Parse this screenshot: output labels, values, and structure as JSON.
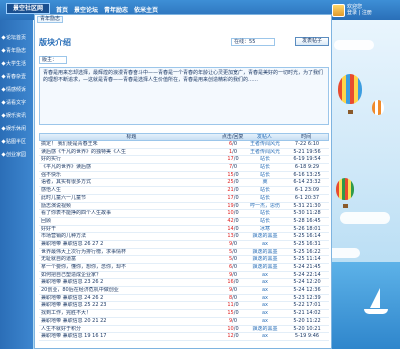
{
  "site": {
    "logo_text": "景空社区网"
  },
  "top_nav": [
    "首页",
    "景空论坛",
    "青年励志",
    "依米主页"
  ],
  "user": {
    "line1": "欢迎您",
    "line2": "登录 | 注册"
  },
  "sidebar": [
    "论坛首页",
    "青年励志",
    "大学生活",
    "青春杂壹",
    "情感倾诉",
    "请看文字",
    "娱乐资讯",
    "娱乐休闲",
    "贴图半区",
    "创业家园"
  ],
  "breadcrumb": "青年励志",
  "board": {
    "title": "版块介绍",
    "online_label": "在线：",
    "online_count": "55",
    "new_post_label": "发表帖子",
    "moderator_label": "版主：",
    "intro_text": "青春是用来忘却选择，最辉煌的浪漫青春奋斗中——青春是一个青春的年龄让心灵更加宽广，青春是美好的一切时光，为了我们的理想不断追求，—这就是青春——青春是选择人生价值所在，青春是用来创造精彩的我们的……"
  },
  "table": {
    "headers": [
      "标题",
      "点击/回复",
      "发帖人",
      "时间"
    ],
    "rows": [
      {
        "title": "搞定！  我们便是青春王朱",
        "clicks": "6",
        "replies": "0",
        "author": "王者传闻风光",
        "time": "7-22 6:10"
      },
      {
        "title": "读后感《千凡的世界》的独特美《人生",
        "clicks": "1",
        "replies": "0",
        "author": "王者传闻风光",
        "time": "5-21 19:56"
      },
      {
        "title": "好的实行",
        "clicks": "17",
        "replies": "0",
        "author": "站长",
        "time": "6-19 19:54"
      },
      {
        "title": "《平凡的世界》读后感",
        "clicks": "7",
        "replies": "0",
        "author": "站长",
        "time": "6-18 9:29"
      },
      {
        "title": "强不快乐",
        "clicks": "15",
        "replies": "0",
        "author": "站长",
        "time": "6-16 13:25"
      },
      {
        "title": "语者，其实有很多方式",
        "clicks": "25",
        "replies": "0",
        "author": "冀",
        "time": "6-14 23:32"
      },
      {
        "title": "感悟人生",
        "clicks": "21",
        "replies": "0",
        "author": "站长",
        "time": "6-1 23:09"
      },
      {
        "title": "此时儿童六一儿童节",
        "clicks": "17",
        "replies": "0",
        "author": "站长",
        "time": "6-1 20:37"
      },
      {
        "title": "励志演说视频",
        "clicks": "19",
        "replies": "0",
        "author": "哼一杰，思伤",
        "time": "5-31 21:30"
      },
      {
        "title": "看了你表不能挣的四个人生故事",
        "clicks": "10",
        "replies": "0",
        "author": "站长",
        "time": "5-30 11:28"
      },
      {
        "title": "回顾",
        "clicks": "42",
        "replies": "0",
        "author": "站长",
        "time": "5-28 16:45"
      },
      {
        "title": "好好干",
        "clicks": "14",
        "replies": "0",
        "author": "冰寒",
        "time": "5-26 18:01"
      },
      {
        "title": "市场营销的几种方法",
        "clicks": "13",
        "replies": "0",
        "author": "飘逸的黑墨",
        "time": "5-25 16:14"
      },
      {
        "title": "兼职地带  兼职信息 26 27 2",
        "clicks": "9",
        "replies": "0",
        "author": "ax",
        "time": "5-25 16:31"
      },
      {
        "title": "世界最伟大上次行为排行榜，求事情杯",
        "clicks": "5",
        "replies": "0",
        "author": "飘逸的黑墨",
        "time": "5-25 16:22"
      },
      {
        "title": "无耻就自的道富",
        "clicks": "5",
        "replies": "0",
        "author": "飘逸的黑墨",
        "time": "5-25 11:14"
      },
      {
        "title": "拿一个要你，懂你，想你，念你，却不",
        "clicks": "6",
        "replies": "0",
        "author": "飘逸的黑墨",
        "time": "5-24 21:45"
      },
      {
        "title": "如何把自己塑造成企业家？",
        "clicks": "9",
        "replies": "0",
        "author": "ax",
        "time": "5-24 22:14"
      },
      {
        "title": "兼职地带  兼职信息 23 26 2",
        "clicks": "16",
        "replies": "0",
        "author": "ax",
        "time": "5-24 12:20"
      },
      {
        "title": "20创业，80后在经济危机中做创业",
        "clicks": "9",
        "replies": "0",
        "author": "ax",
        "time": "5-24 12:36"
      },
      {
        "title": "兼职地带  兼职信息 24 26 2",
        "clicks": "8",
        "replies": "0",
        "author": "ax",
        "time": "5-23 12:39"
      },
      {
        "title": "兼职地带  兼职信息 25 22 23",
        "clicks": "11",
        "replies": "0",
        "author": "ax",
        "time": "5-22 17:01"
      },
      {
        "title": "找到工作，完胜不大！",
        "clicks": "15",
        "replies": "0",
        "author": "ax",
        "time": "5-21 14:02"
      },
      {
        "title": "兼职地带  兼职信息 20 21 22",
        "clicks": "9",
        "replies": "0",
        "author": "ax",
        "time": "5-20 11:22"
      },
      {
        "title": "人生不就好于积分",
        "clicks": "10",
        "replies": "0",
        "author": "飘逸的黑墨",
        "time": "5-20 10:21"
      },
      {
        "title": "兼职地带  兼职信息 19 16 17",
        "clicks": "12",
        "replies": "0",
        "author": "ax",
        "time": "5-19 9:46"
      }
    ]
  },
  "colors": {
    "brand": "#2a6fb8",
    "reply_count": "#d22222",
    "link": "#2a6fb8"
  },
  "icons": [
    "avatar-icon",
    "nav-bullet-icon",
    "balloon-decoration",
    "sailboat-decoration"
  ]
}
